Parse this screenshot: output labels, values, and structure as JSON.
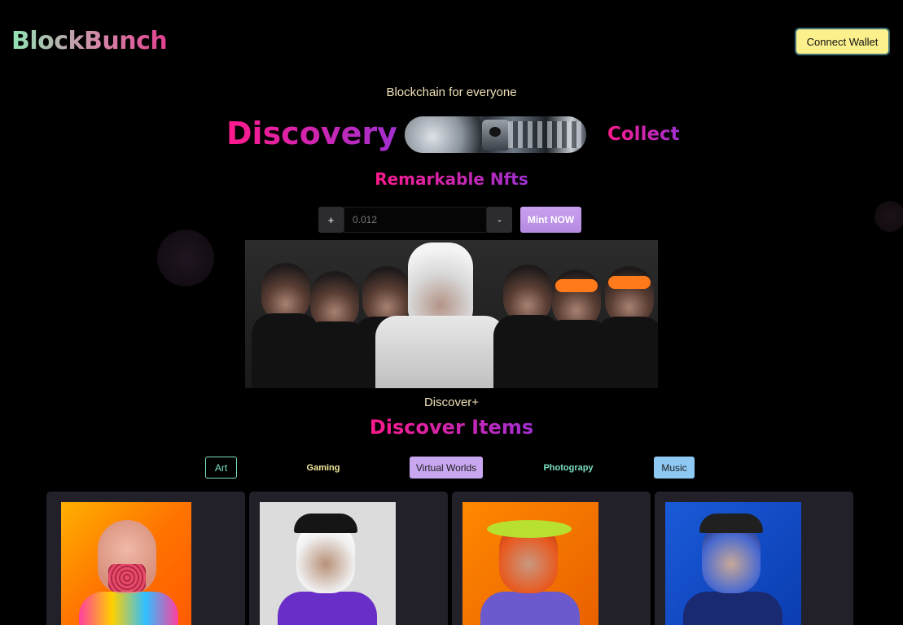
{
  "header": {
    "logo": "BlockBunch",
    "connect_wallet_label": "Connect Wallet"
  },
  "hero": {
    "tagline": "Blockchain for everyone",
    "word_left": "Discovery",
    "word_right": "Collect",
    "subtitle": "Remarkable Nfts"
  },
  "mint": {
    "increment_label": "+",
    "decrement_label": "-",
    "price_value": "0.012",
    "mint_label": "Mint NOW"
  },
  "banner": {
    "caption": "Discover+"
  },
  "discover": {
    "title": "Discover Items",
    "filters": [
      {
        "label": "Art"
      },
      {
        "label": "Gaming"
      },
      {
        "label": "Virtual Worlds"
      },
      {
        "label": "Photograpy"
      },
      {
        "label": "Music"
      }
    ]
  },
  "colors": {
    "accent_pink": "#ff1a8c",
    "accent_purple": "#a030d0",
    "wallet_button": "#fbf08c",
    "card_bg": "#22212a"
  }
}
